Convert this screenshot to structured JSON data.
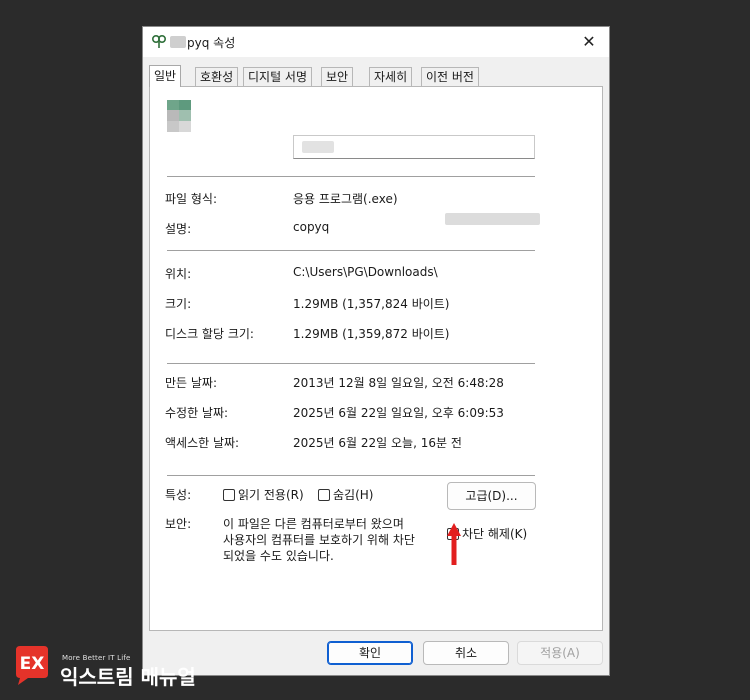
{
  "window": {
    "title": "pyq 속성",
    "close_glyph": "✕"
  },
  "tabs": [
    {
      "label": "일반",
      "active": true
    },
    {
      "label": "호환성",
      "active": false
    },
    {
      "label": "디지털 서명",
      "active": false
    },
    {
      "label": "보안",
      "active": false
    },
    {
      "label": "자세히",
      "active": false
    },
    {
      "label": "이전 버전",
      "active": false
    }
  ],
  "general": {
    "file_type_label": "파일 형식:",
    "file_type_value": "응용 프로그램(.exe)",
    "description_label": "설명:",
    "description_value": "copyq",
    "location_label": "위치:",
    "location_value": "C:\\Users\\PG\\Downloads\\",
    "size_label": "크기:",
    "size_value": "1.29MB (1,357,824 바이트)",
    "disk_size_label": "디스크 할당 크기:",
    "disk_size_value": "1.29MB (1,359,872 바이트)",
    "created_label": "만든 날짜:",
    "created_value": "2013년 12월 8일 일요일, 오전 6:48:28",
    "modified_label": "수정한 날짜:",
    "modified_value": "2025년 6월 22일 일요일, 오후 6:09:53",
    "accessed_label": "액세스한 날짜:",
    "accessed_value": "2025년 6월 22일 오늘, 16분 전",
    "attributes_label": "특성:",
    "readonly_label": "읽기 전용(R)",
    "hidden_label": "숨김(H)",
    "advanced_button": "고급(D)...",
    "security_label": "보안:",
    "security_text_1": "이 파일은 다른 컴퓨터로부터 왔으며",
    "security_text_2": "사용자의 컴퓨터를 보호하기 위해 차단",
    "security_text_3": "되었을 수도 있습니다.",
    "unblock_label": "차단 해제(K)"
  },
  "footer": {
    "ok": "확인",
    "cancel": "취소",
    "apply": "적용(A)"
  },
  "watermark": {
    "small": "More Better IT Life",
    "big": "익스트림 매뉴얼",
    "logo_text": "EX"
  },
  "colors": {
    "background": "#2b2b2b",
    "accent": "#0f5fd1",
    "arrow": "#e21f1f",
    "logo": "#e5332a"
  }
}
